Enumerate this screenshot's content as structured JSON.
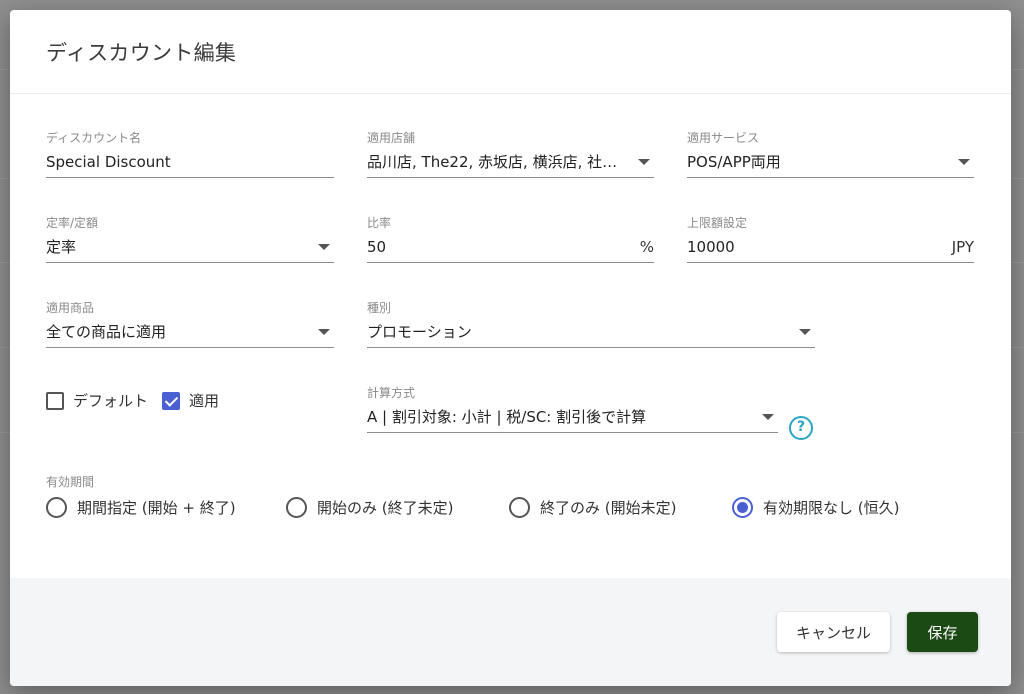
{
  "dialog": {
    "title": "ディスカウント編集"
  },
  "fields": {
    "discount_name": {
      "label": "ディスカウント名",
      "value": "Special Discount"
    },
    "stores": {
      "label": "適用店舗",
      "value": "品川店, The22, 赤坂店, 横浜店, 社…"
    },
    "service": {
      "label": "適用サービス",
      "value": "POS/APP両用"
    },
    "rate_type": {
      "label": "定率/定額",
      "value": "定率"
    },
    "ratio": {
      "label": "比率",
      "value": "50",
      "suffix": "%"
    },
    "max_amount": {
      "label": "上限額設定",
      "value": "10000",
      "suffix": "JPY"
    },
    "products": {
      "label": "適用商品",
      "value": "全ての商品に適用"
    },
    "kind": {
      "label": "種別",
      "value": "プロモーション"
    },
    "calc_method": {
      "label": "計算方式",
      "value": "A | 割引対象: 小計 | 税/SC: 割引後で計算"
    }
  },
  "checkboxes": {
    "default": {
      "label": "デフォルト",
      "checked": false
    },
    "apply": {
      "label": "適用",
      "checked": true
    }
  },
  "validity": {
    "label": "有効期間",
    "options": [
      {
        "label": "期間指定 (開始 + 終了)",
        "selected": false
      },
      {
        "label": "開始のみ (終了未定)",
        "selected": false
      },
      {
        "label": "終了のみ (開始未定)",
        "selected": false
      },
      {
        "label": "有効期限なし (恒久)",
        "selected": true
      }
    ]
  },
  "help_icon": {
    "glyph": "?",
    "color": "#2aa5c1"
  },
  "footer": {
    "cancel_label": "キャンセル",
    "save_label": "保存"
  },
  "colors": {
    "accent": "#4a5fd1",
    "save_button": "#1c4a15",
    "help": "#2aa5c1"
  }
}
